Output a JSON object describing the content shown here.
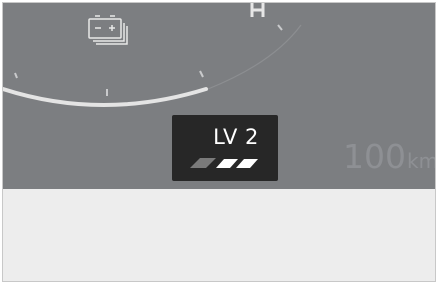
{
  "cluster": {
    "gauge": {
      "fill_fraction": 0.55,
      "icons": [
        "battery-icon",
        "high-beam-icon"
      ]
    },
    "lv_indicator": {
      "label": "LV 2",
      "icon": "lane-level-stripes-icon"
    },
    "speed": {
      "value": "100",
      "unit": "km"
    }
  },
  "colors": {
    "cluster_background": "#7c7e81",
    "indicator_background": "#272727",
    "indicator_text": "#ffffff",
    "gauge_arc": "#e6e6e6",
    "speed_text": "#8e9094",
    "lower_panel": "#ededed"
  }
}
